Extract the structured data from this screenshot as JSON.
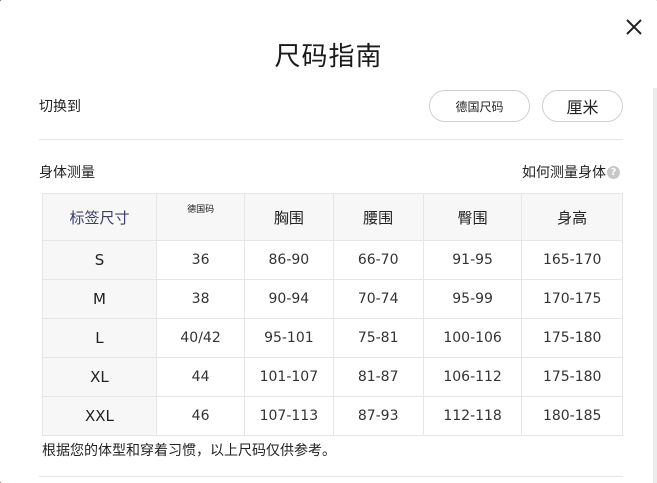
{
  "modal": {
    "title": "尺码指南",
    "switch_label": "切换到",
    "unit_buttons": {
      "german": "德国尺码",
      "cm": "厘米"
    },
    "measure_label": "身体测量",
    "howto_label": "如何测量身体",
    "howto_icon": "question-icon",
    "close_icon": "close-icon",
    "note": "根据您的体型和穿着习惯，以上尺码仅供参考。"
  },
  "table": {
    "headers": [
      "标签尺寸",
      "德国码",
      "胸围",
      "腰围",
      "臀围",
      "身高"
    ],
    "rows": [
      [
        "S",
        "36",
        "86-90",
        "66-70",
        "91-95",
        "165-170"
      ],
      [
        "M",
        "38",
        "90-94",
        "70-74",
        "95-99",
        "170-175"
      ],
      [
        "L",
        "40/42",
        "95-101",
        "75-81",
        "100-106",
        "175-180"
      ],
      [
        "XL",
        "44",
        "101-107",
        "81-87",
        "106-112",
        "175-180"
      ],
      [
        "XXL",
        "46",
        "107-113",
        "87-93",
        "112-118",
        "180-185"
      ]
    ]
  }
}
